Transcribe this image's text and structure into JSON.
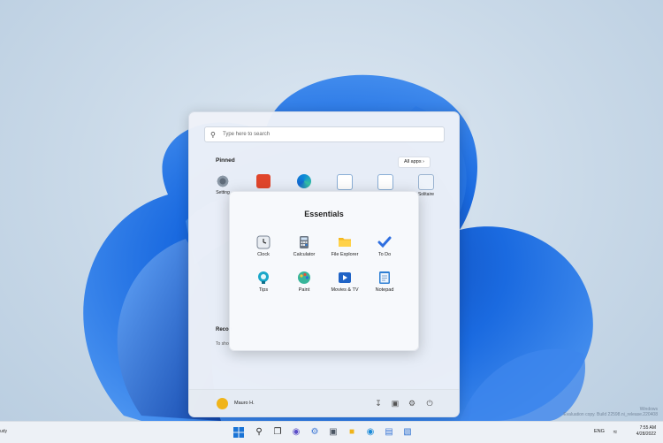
{
  "search": {
    "placeholder": "Type here to search"
  },
  "pinned": {
    "title": "Pinned",
    "all_apps": "All apps",
    "apps": [
      {
        "label": "Setting",
        "icon": "gear-icon"
      },
      {
        "label": "",
        "icon": "office-icon"
      },
      {
        "label": "",
        "icon": "edge-icon"
      },
      {
        "label": "",
        "icon": "mail-icon"
      },
      {
        "label": "",
        "icon": "photos-icon"
      },
      {
        "label": "Solitaire",
        "icon": "solitaire-icon"
      }
    ]
  },
  "recommended": {
    "title": "Recon",
    "text": "To sho"
  },
  "user": {
    "name": "Mauro H."
  },
  "folder": {
    "title": "Essentials",
    "apps": [
      {
        "label": "Clock",
        "icon": "clock-icon"
      },
      {
        "label": "Calculator",
        "icon": "calculator-icon"
      },
      {
        "label": "File Explorer",
        "icon": "folder-icon"
      },
      {
        "label": "To Do",
        "icon": "checkmark-icon"
      },
      {
        "label": "Tips",
        "icon": "tips-icon"
      },
      {
        "label": "Paint",
        "icon": "paint-icon"
      },
      {
        "label": "Movies & TV",
        "icon": "movies-icon"
      },
      {
        "label": "Notepad",
        "icon": "notepad-icon"
      }
    ]
  },
  "taskbar": {
    "left_text": "udy",
    "language": "ENG",
    "time": "7:55 AM",
    "date": "4/28/2022"
  },
  "watermark": {
    "line1": "Windows",
    "line2": "Evaluation copy. Build 22598.ni_release.220408"
  },
  "colors": {
    "accent": "#0067c0",
    "wallpaper_bloom": "#1560d6"
  }
}
